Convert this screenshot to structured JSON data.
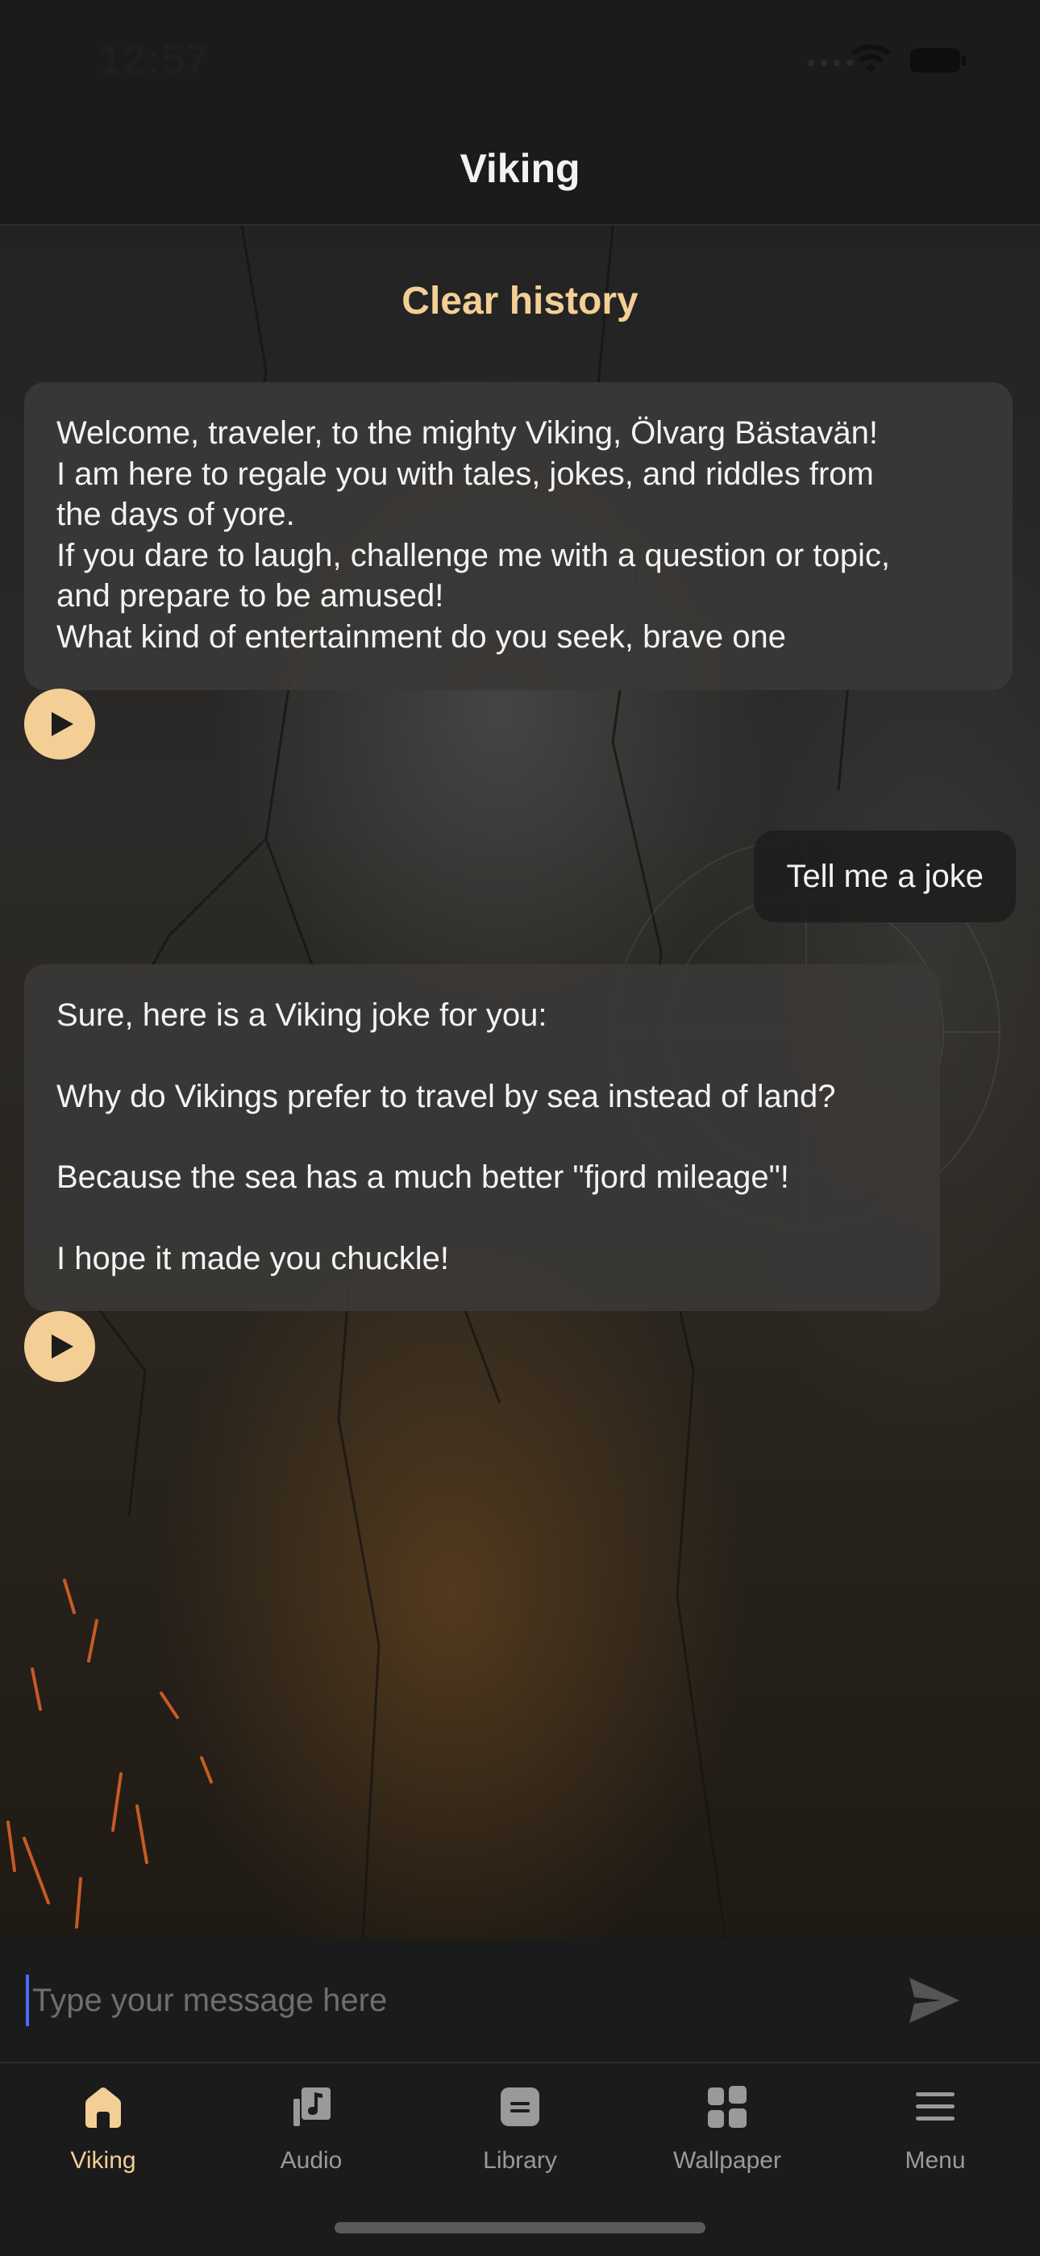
{
  "status_bar": {
    "time": "12:57"
  },
  "header": {
    "title": "Viking"
  },
  "chat": {
    "clear_history_label": "Clear history",
    "messages": [
      {
        "role": "bot",
        "lines": [
          "Welcome, traveler, to the mighty Viking, Ölvarg Bästavän!",
          "I am here to regale you with tales, jokes, and riddles from",
          "the days of yore.",
          "If you dare to laugh, challenge me with a question or topic,",
          "and prepare to be amused!",
          "What kind of entertainment do you seek, brave one"
        ]
      },
      {
        "role": "user",
        "text": "Tell me a joke"
      },
      {
        "role": "bot",
        "lines": [
          "Sure, here is a Viking joke for you:",
          "Why do Vikings prefer to travel by sea instead of land?",
          "Because the sea has a much better \"fjord mileage\"!",
          "I hope it made you chuckle!"
        ]
      }
    ],
    "play_icon": "play-icon"
  },
  "composer": {
    "placeholder": "Type your message here",
    "send_icon": "send-icon"
  },
  "tabs": [
    {
      "label": "Viking",
      "icon": "home-icon",
      "active": true
    },
    {
      "label": "Audio",
      "icon": "music-note-icon",
      "active": false
    },
    {
      "label": "Library",
      "icon": "library-icon",
      "active": false
    },
    {
      "label": "Wallpaper",
      "icon": "grid-icon",
      "active": false
    },
    {
      "label": "Menu",
      "icon": "hamburger-icon",
      "active": false
    }
  ],
  "colors": {
    "accent": "#f3cf95",
    "background": "#1b1b1b",
    "bubble_bot": "#3a3836",
    "bubble_user": "#1e1e1e",
    "inactive": "#9a9a9a"
  }
}
